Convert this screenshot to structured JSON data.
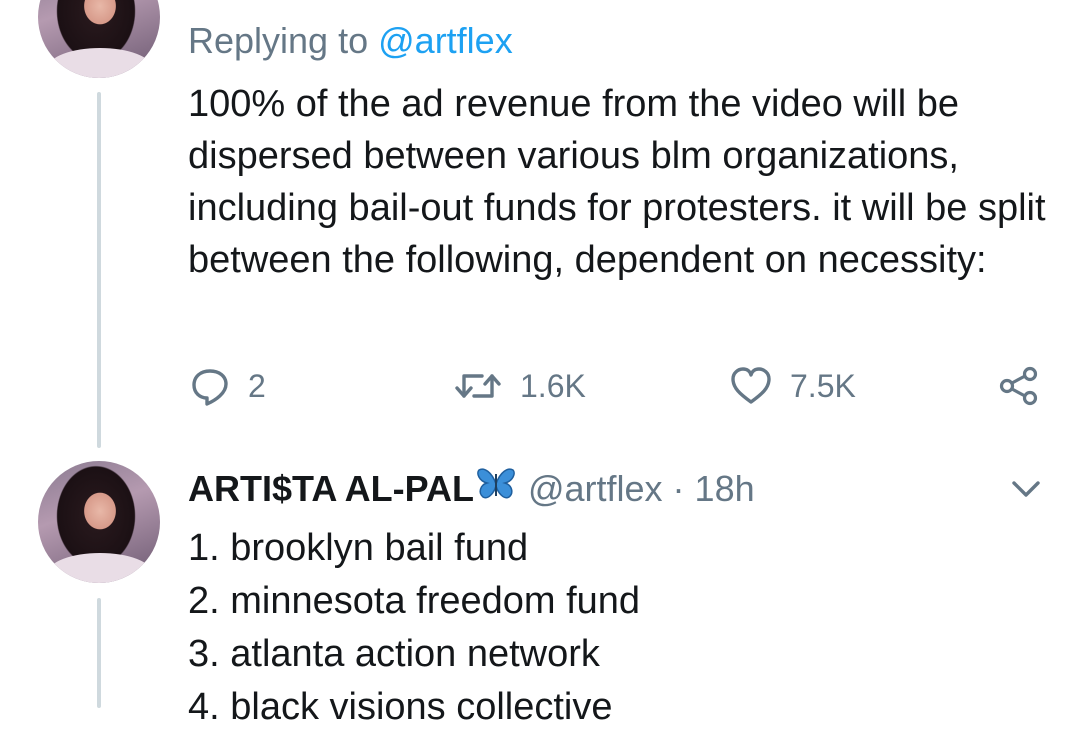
{
  "first_tweet": {
    "replying_prefix": "Replying to",
    "replying_handle": "@artflex",
    "text": "100% of the ad revenue from the video will be dispersed between various blm organizations, including bail-out funds for protesters. it will be split between the following, dependent on necessity:",
    "actions": {
      "reply_count": "2",
      "retweet_count": "1.6K",
      "like_count": "7.5K"
    }
  },
  "second_tweet": {
    "display_name": "ARTI$TA AL-PAL",
    "handle": "@artflex",
    "separator": "·",
    "timestamp": "18h",
    "list_items": [
      "1. brooklyn bail fund",
      "2. minnesota freedom fund",
      "3. atlanta action network",
      "4. black visions collective"
    ]
  },
  "colors": {
    "text": "#14171a",
    "secondary": "#657786",
    "link": "#1da1f2",
    "thread_line": "#cfd9de",
    "butterfly": "#3b8fd9"
  },
  "icons": [
    "reply-icon",
    "retweet-icon",
    "like-icon",
    "share-icon",
    "chevron-down-icon",
    "butterfly-emoji"
  ]
}
